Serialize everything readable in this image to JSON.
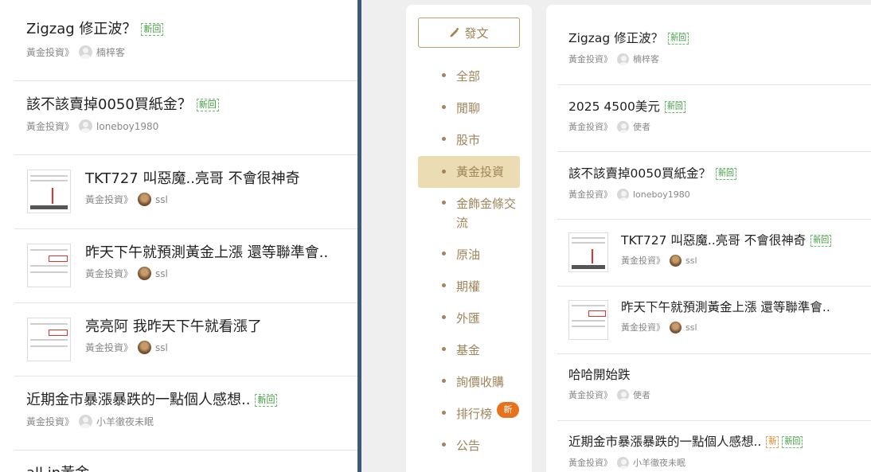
{
  "left_list": [
    {
      "title": "Zigzag 修正波？",
      "badge": "新回",
      "board": "黃金投資》",
      "author": "楠梓客"
    },
    {
      "title": "該不該賣掉0050買紙金？",
      "badge": "新回",
      "board": "黃金投資》",
      "author": "loneboy1980"
    },
    {
      "title": "TKT727 叫惡魔..亮哥 不會很神奇",
      "board": "黃金投資》",
      "author": "ssl"
    },
    {
      "title": "昨天下午就預測黃金上漲 還等聯準會..",
      "board": "黃金投資》",
      "author": "ssl"
    },
    {
      "title": "亮亮阿 我昨天下午就看漲了",
      "board": "黃金投資》",
      "author": "ssl"
    },
    {
      "title": "近期金市暴漲暴跌的一點個人感想..",
      "badge": "新回",
      "board": "黃金投資》",
      "author": "小羊徹夜未眠"
    },
    {
      "title": "all in黃金"
    }
  ],
  "nav": {
    "post_button": "發文",
    "items": [
      "全部",
      "閒聊",
      "股市",
      "黃金投資",
      "金飾金條交流",
      "原油",
      "期權",
      "外匯",
      "基金",
      "詢價收購",
      "排行榜",
      "公告"
    ],
    "active": "黃金投資",
    "hot_badge": "新"
  },
  "right_list": [
    {
      "title": "Zigzag 修正波？",
      "badge": "新回",
      "board": "黃金投資》",
      "author": "楠梓客"
    },
    {
      "title": "2025 4500美元",
      "badge": "新回",
      "board": "黃金投資》",
      "author": "使者"
    },
    {
      "title": "該不該賣掉0050買紙金？",
      "badge": "新回",
      "board": "黃金投資》",
      "author": "loneboy1980"
    },
    {
      "title": "TKT727 叫惡魔..亮哥 不會很神奇",
      "badge": "新回",
      "board": "黃金投資》",
      "author": "ssl"
    },
    {
      "title": "昨天下午就預測黃金上漲 還等聯準會..",
      "board": "黃金投資》",
      "author": "ssl"
    },
    {
      "title": "哈哈開始跌",
      "board": "黃金投資》",
      "author": "使者"
    },
    {
      "title": "近期金市暴漲暴跌的一點個人感想..",
      "badge_orange": "新",
      "badge": "新回",
      "board": "黃金投資》",
      "author": "小羊徹夜未眠"
    }
  ]
}
